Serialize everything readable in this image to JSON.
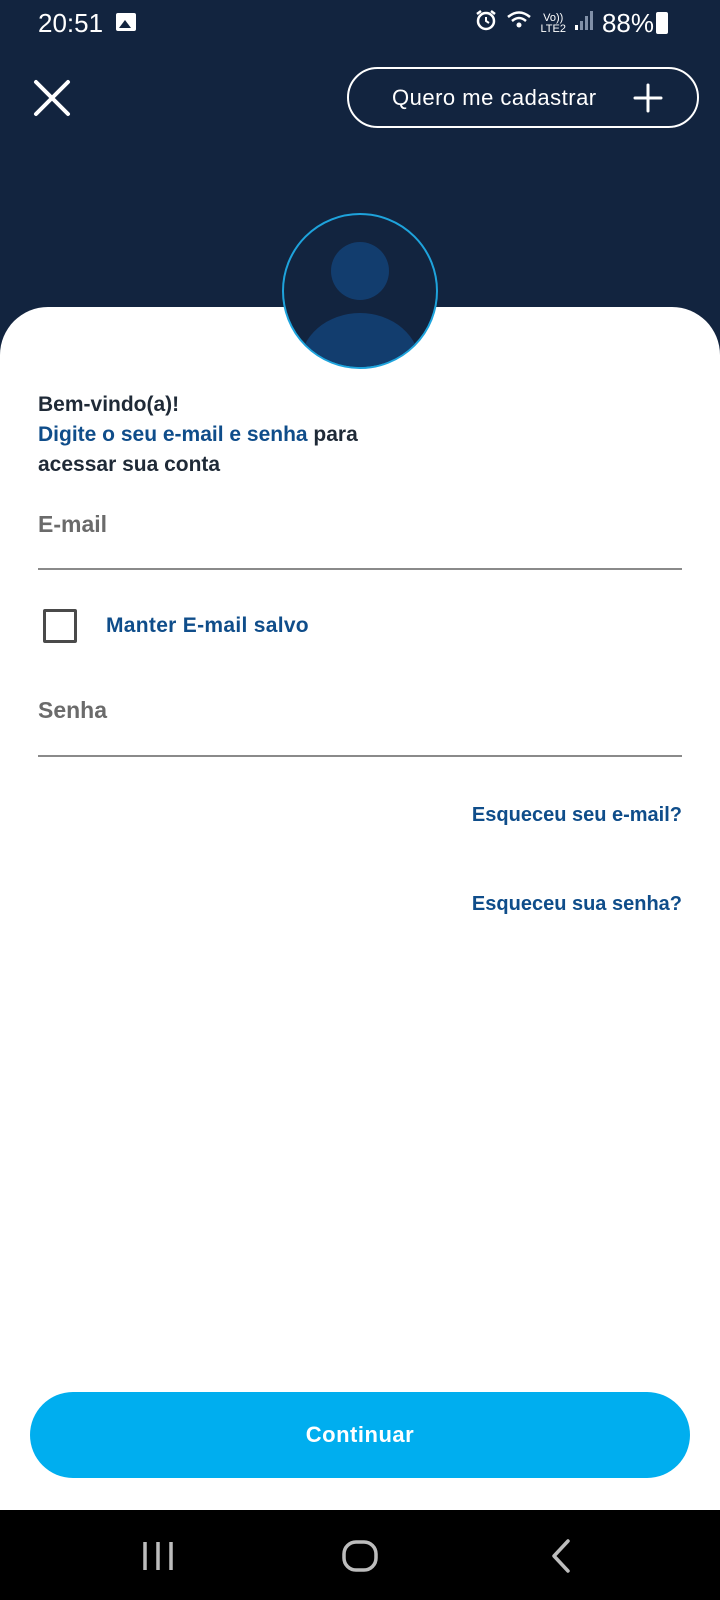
{
  "status_bar": {
    "time": "20:51",
    "battery_percent": "88%",
    "network_line1": "Vo))",
    "network_line2": "LTE2",
    "icons": [
      "gallery-icon",
      "alarm-icon",
      "wifi-icon",
      "signal-icon",
      "battery-icon"
    ]
  },
  "header": {
    "close_icon": "close-icon",
    "signup_label": "Quero me cadastrar",
    "signup_icon": "plus-icon"
  },
  "avatar": {
    "icon": "user-avatar-icon"
  },
  "welcome": {
    "line1": "Bem-vindo(a)!",
    "line2_accent": "Digite o seu e-mail e senha",
    "line2_rest": " para",
    "line3": "acessar sua conta"
  },
  "form": {
    "email_placeholder": "E-mail",
    "email_value": "",
    "remember_label": "Manter E-mail salvo",
    "remember_checked": false,
    "password_placeholder": "Senha",
    "password_value": "",
    "forgot_email": "Esqueceu seu e-mail?",
    "forgot_password": "Esqueceu sua senha?"
  },
  "actions": {
    "continue_label": "Continuar"
  },
  "nav_bar": {
    "icons": [
      "recent-apps-icon",
      "home-icon",
      "back-icon"
    ]
  },
  "colors": {
    "header_bg": "#12243f",
    "accent_text": "#0f4d8a",
    "primary_button": "#00aeef",
    "avatar_ring": "#1ea3dc"
  }
}
